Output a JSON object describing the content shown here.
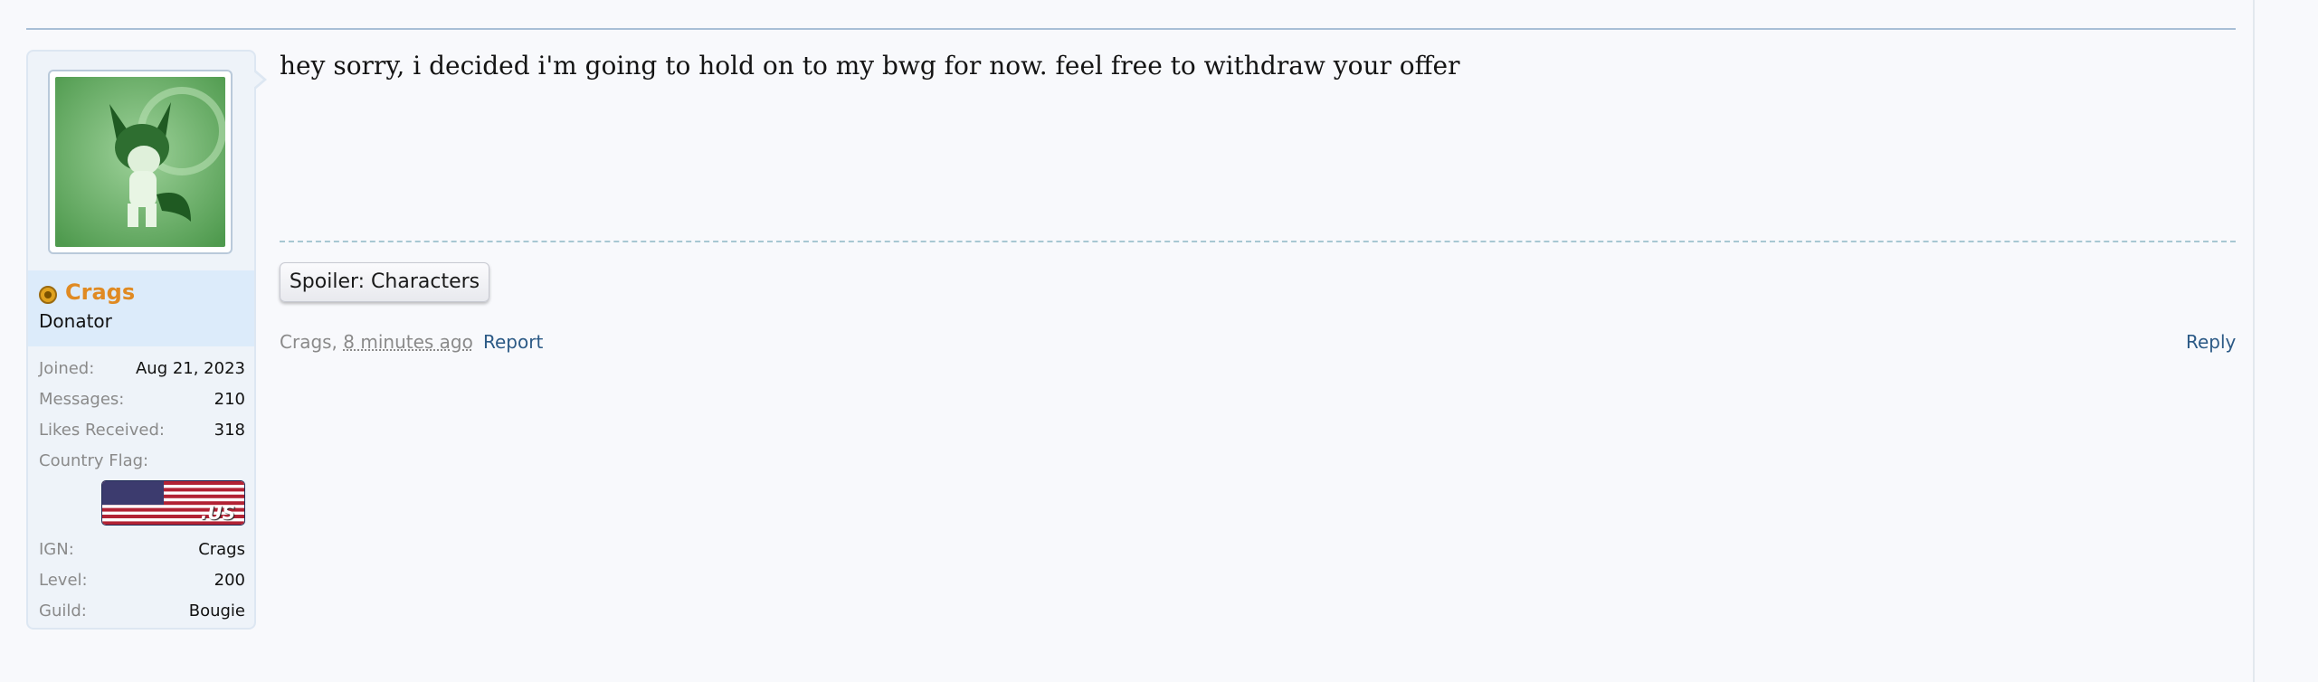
{
  "user": {
    "name": "Crags",
    "title": "Donator",
    "stats": [
      {
        "label": "Joined:",
        "value": "Aug 21, 2023"
      },
      {
        "label": "Messages:",
        "value": "210"
      },
      {
        "label": "Likes Received:",
        "value": "318"
      }
    ],
    "flag_label": "Country Flag:",
    "flag_text": ".US",
    "game_stats": [
      {
        "label": "IGN:",
        "value": "Crags"
      },
      {
        "label": "Level:",
        "value": "200"
      },
      {
        "label": "Guild:",
        "value": "Bougie"
      }
    ]
  },
  "message": {
    "text": "hey sorry, i decided i'm going to hold on to my bwg for now. feel free to withdraw your offer",
    "spoiler_label": "Spoiler: Characters",
    "author": "Crags,",
    "time": "8 minutes ago",
    "report_label": "Report",
    "reply_label": "Reply"
  },
  "colors": {
    "username": "#e08a22",
    "link": "#2c5a86",
    "name_panel": "#dcebfa"
  },
  "icons": {
    "badge": "donator-badge-icon",
    "flag": "us-flag-icon"
  }
}
